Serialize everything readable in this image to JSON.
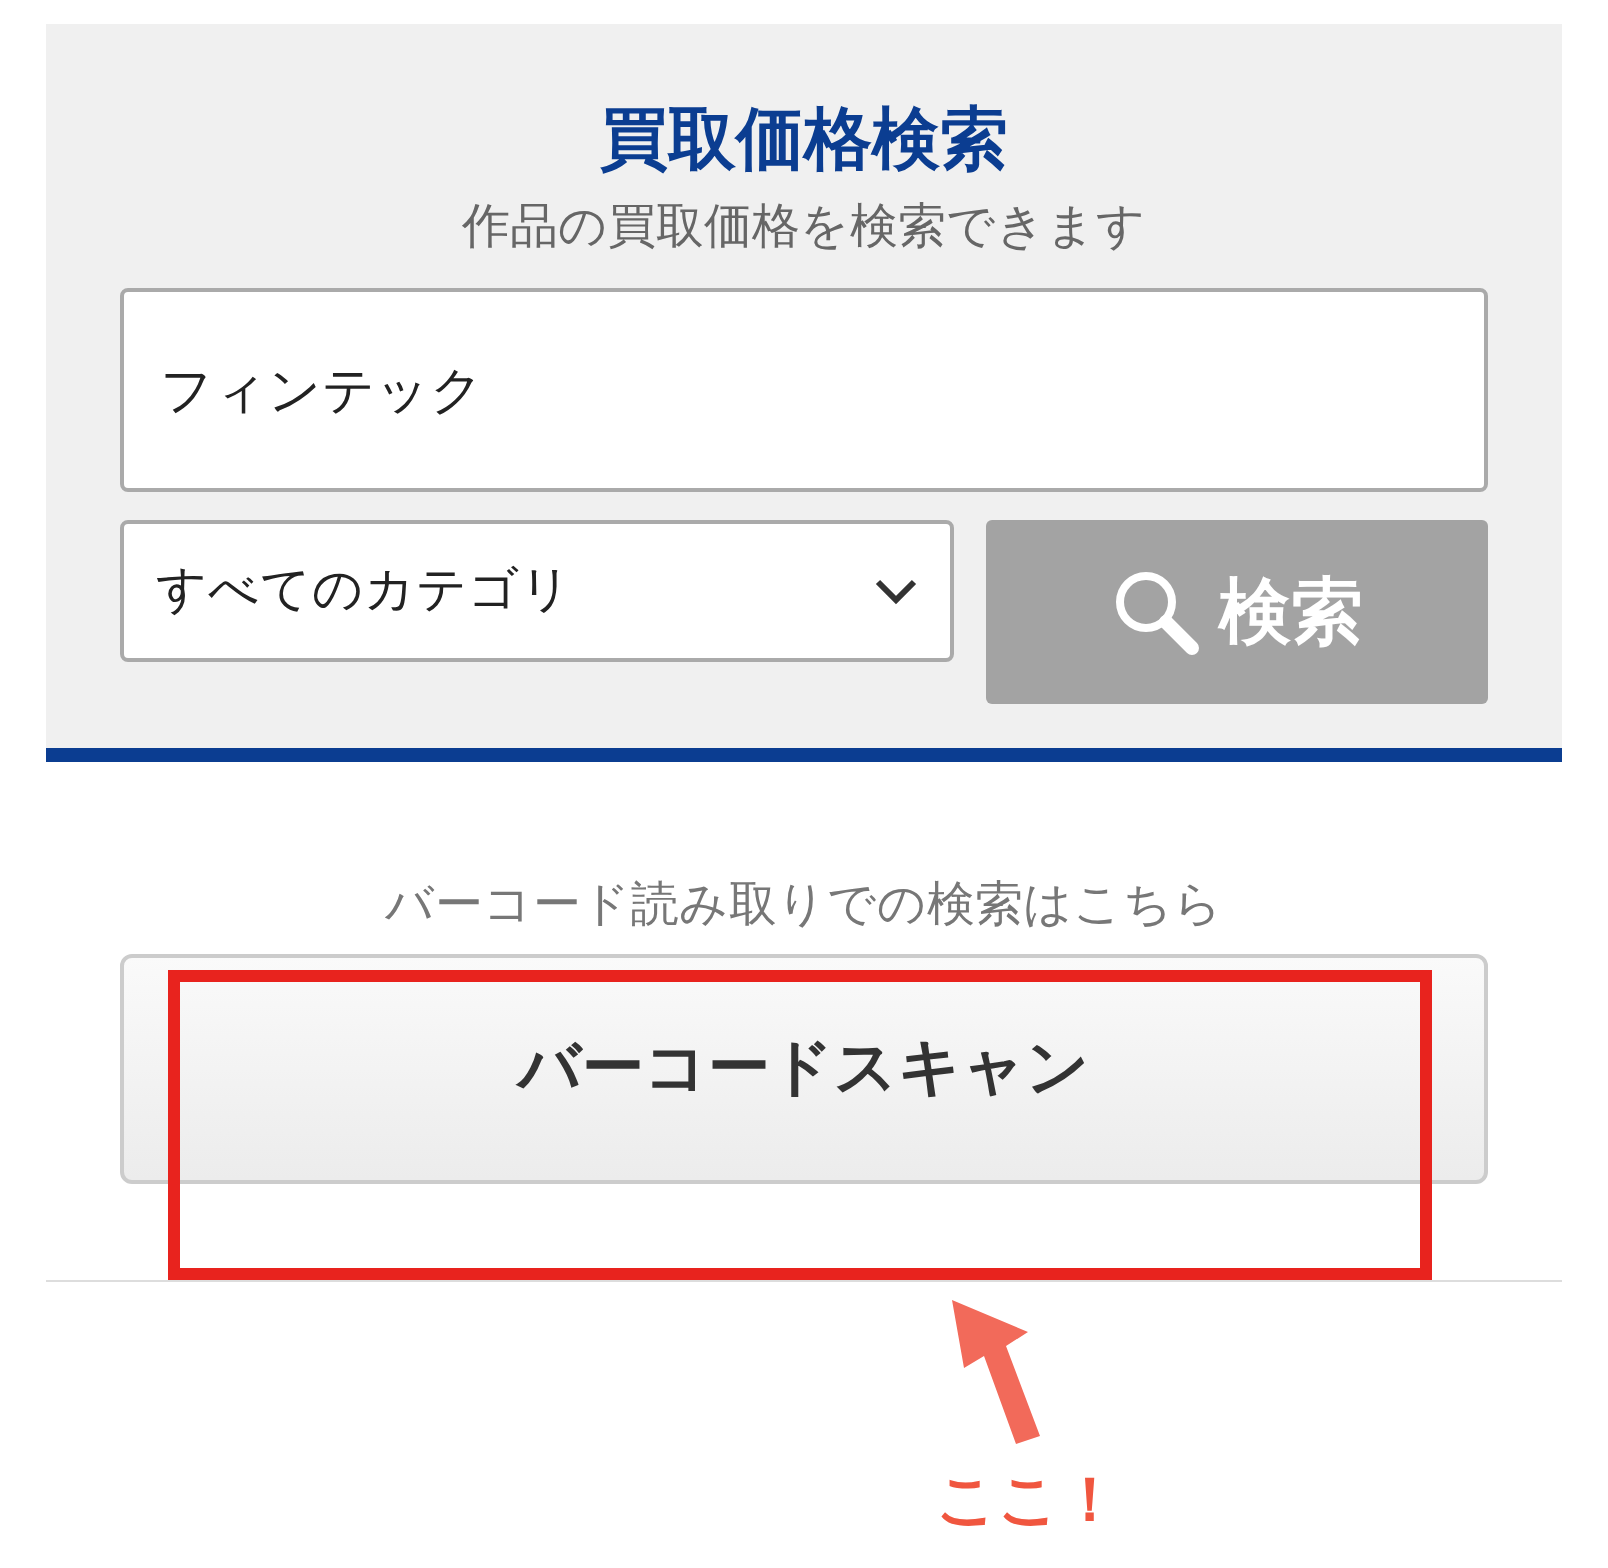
{
  "search_panel": {
    "title": "買取価格検索",
    "subtitle": "作品の買取価格を検索できます",
    "keyword_field": {
      "value": "フィンテック"
    },
    "category_select": {
      "value": "すべてのカテゴリ"
    },
    "search_button": {
      "label": "検索"
    }
  },
  "barcode": {
    "hint": "バーコード読み取りでの検索はこちら",
    "button": {
      "label": "バーコードスキャン"
    }
  },
  "annotation": {
    "label": "ここ！"
  }
}
